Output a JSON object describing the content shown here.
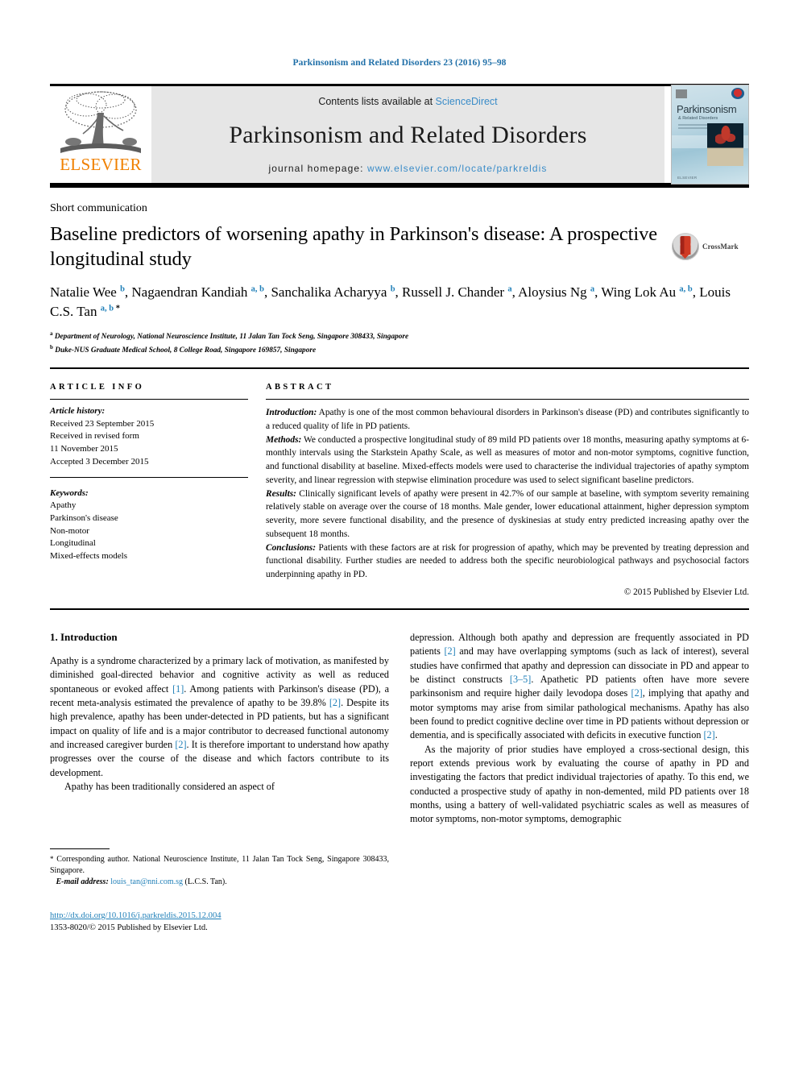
{
  "running_head": "Parkinsonism and Related Disorders 23 (2016) 95–98",
  "masthead": {
    "elsevier_wordmark": "ELSEVIER",
    "contents_prefix": "Contents lists available at ",
    "contents_link": "ScienceDirect",
    "journal_title": "Parkinsonism and Related Disorders",
    "homepage_prefix": "journal homepage: ",
    "homepage_url": "www.elsevier.com/locate/parkreldis",
    "cover": {
      "title": "Parkinsonism",
      "subtitle": "& Related Disorders",
      "footer": "ELSEVIER"
    }
  },
  "article": {
    "type": "Short communication",
    "title": "Baseline predictors of worsening apathy in Parkinson's disease: A prospective longitudinal study",
    "crossmark_label": "CrossMark",
    "authors": [
      {
        "name": "Natalie Wee",
        "marks": "b",
        "sep": ", "
      },
      {
        "name": "Nagaendran Kandiah",
        "marks": "a, b",
        "sep": ", "
      },
      {
        "name": "Sanchalika Acharyya",
        "marks": "b",
        "sep": ", "
      },
      {
        "name": "Russell J. Chander",
        "marks": "a",
        "sep": ", "
      },
      {
        "name": "Aloysius Ng",
        "marks": "a",
        "sep": ", "
      },
      {
        "name": "Wing Lok Au",
        "marks": "a, b",
        "sep": ", "
      },
      {
        "name": "Louis C.S. Tan",
        "marks": "a, b",
        "star": "*",
        "sep": ""
      }
    ],
    "affiliations": [
      {
        "mark": "a",
        "text": "Department of Neurology, National Neuroscience Institute, 11 Jalan Tan Tock Seng, Singapore 308433, Singapore"
      },
      {
        "mark": "b",
        "text": "Duke-NUS Graduate Medical School, 8 College Road, Singapore 169857, Singapore"
      }
    ]
  },
  "info": {
    "heading": "ARTICLE INFO",
    "history_label": "Article history:",
    "history": [
      "Received 23 September 2015",
      "Received in revised form",
      "11 November 2015",
      "Accepted 3 December 2015"
    ],
    "keywords_label": "Keywords:",
    "keywords": [
      "Apathy",
      "Parkinson's disease",
      "Non-motor",
      "Longitudinal",
      "Mixed-effects models"
    ]
  },
  "abstract": {
    "heading": "ABSTRACT",
    "sections": [
      {
        "label": "Introduction:",
        "text": " Apathy is one of the most common behavioural disorders in Parkinson's disease (PD) and contributes significantly to a reduced quality of life in PD patients."
      },
      {
        "label": "Methods:",
        "text": " We conducted a prospective longitudinal study of 89 mild PD patients over 18 months, measuring apathy symptoms at 6-monthly intervals using the Starkstein Apathy Scale, as well as measures of motor and non-motor symptoms, cognitive function, and functional disability at baseline. Mixed-effects models were used to characterise the individual trajectories of apathy symptom severity, and linear regression with stepwise elimination procedure was used to select significant baseline predictors."
      },
      {
        "label": "Results:",
        "text": " Clinically significant levels of apathy were present in 42.7% of our sample at baseline, with symptom severity remaining relatively stable on average over the course of 18 months. Male gender, lower educational attainment, higher depression symptom severity, more severe functional disability, and the presence of dyskinesias at study entry predicted increasing apathy over the subsequent 18 months."
      },
      {
        "label": "Conclusions:",
        "text": " Patients with these factors are at risk for progression of apathy, which may be prevented by treating depression and functional disability. Further studies are needed to address both the specific neurobiological pathways and psychosocial factors underpinning apathy in PD."
      }
    ],
    "copyright": "© 2015 Published by Elsevier Ltd."
  },
  "introduction": {
    "heading": "1. Introduction",
    "left_paragraphs": [
      {
        "parts": [
          {
            "t": "Apathy is a syndrome characterized by a primary lack of motivation, as manifested by diminished goal-directed behavior and cognitive activity as well as reduced spontaneous or evoked affect "
          },
          {
            "t": "[1]",
            "ref": true
          },
          {
            "t": ". Among patients with Parkinson's disease (PD), a recent meta-analysis estimated the prevalence of apathy to be 39.8% "
          },
          {
            "t": "[2]",
            "ref": true
          },
          {
            "t": ". Despite its high prevalence, apathy has been under-detected in PD patients, but has a significant impact on quality of life and is a major contributor to decreased functional autonomy and increased caregiver burden "
          },
          {
            "t": "[2]",
            "ref": true
          },
          {
            "t": ". It is therefore important to understand how apathy progresses over the course of the disease and which factors contribute to its development."
          }
        ],
        "indent": false
      },
      {
        "parts": [
          {
            "t": "Apathy has been traditionally considered an aspect of"
          }
        ],
        "indent": true
      }
    ],
    "right_paragraphs": [
      {
        "parts": [
          {
            "t": "depression. Although both apathy and depression are frequently associated in PD patients "
          },
          {
            "t": "[2]",
            "ref": true
          },
          {
            "t": " and may have overlapping symptoms (such as lack of interest), several studies have confirmed that apathy and depression can dissociate in PD and appear to be distinct constructs "
          },
          {
            "t": "[3–5]",
            "ref": true
          },
          {
            "t": ". Apathetic PD patients often have more severe parkinsonism and require higher daily levodopa doses "
          },
          {
            "t": "[2]",
            "ref": true
          },
          {
            "t": ", implying that apathy and motor symptoms may arise from similar pathological mechanisms. Apathy has also been found to predict cognitive decline over time in PD patients without depression or dementia, and is specifically associated with deficits in executive function "
          },
          {
            "t": "[2]",
            "ref": true
          },
          {
            "t": "."
          }
        ],
        "indent": false
      },
      {
        "parts": [
          {
            "t": "As the majority of prior studies have employed a cross-sectional design, this report extends previous work by evaluating the course of apathy in PD and investigating the factors that predict individual trajectories of apathy. To this end, we conducted a prospective study of apathy in non-demented, mild PD patients over 18 months, using a battery of well-validated psychiatric scales as well as measures of motor symptoms, non-motor symptoms, demographic"
          }
        ],
        "indent": true
      }
    ]
  },
  "footnotes": {
    "corresponding_star": "*",
    "corresponding_text": " Corresponding author. National Neuroscience Institute, 11 Jalan Tan Tock Seng, Singapore 308433, Singapore.",
    "email_label": "E-mail address:",
    "email": "louis_tan@nni.com.sg",
    "email_suffix": " (L.C.S. Tan).",
    "doi": "http://dx.doi.org/10.1016/j.parkreldis.2015.12.004",
    "issn_line": "1353-8020/© 2015 Published by Elsevier Ltd."
  },
  "colors": {
    "link_blue": "#1f7fb8",
    "masthead_link": "#3a8cc8",
    "elsevier_orange": "#f08000",
    "masthead_bg": "#e6e6e6"
  }
}
